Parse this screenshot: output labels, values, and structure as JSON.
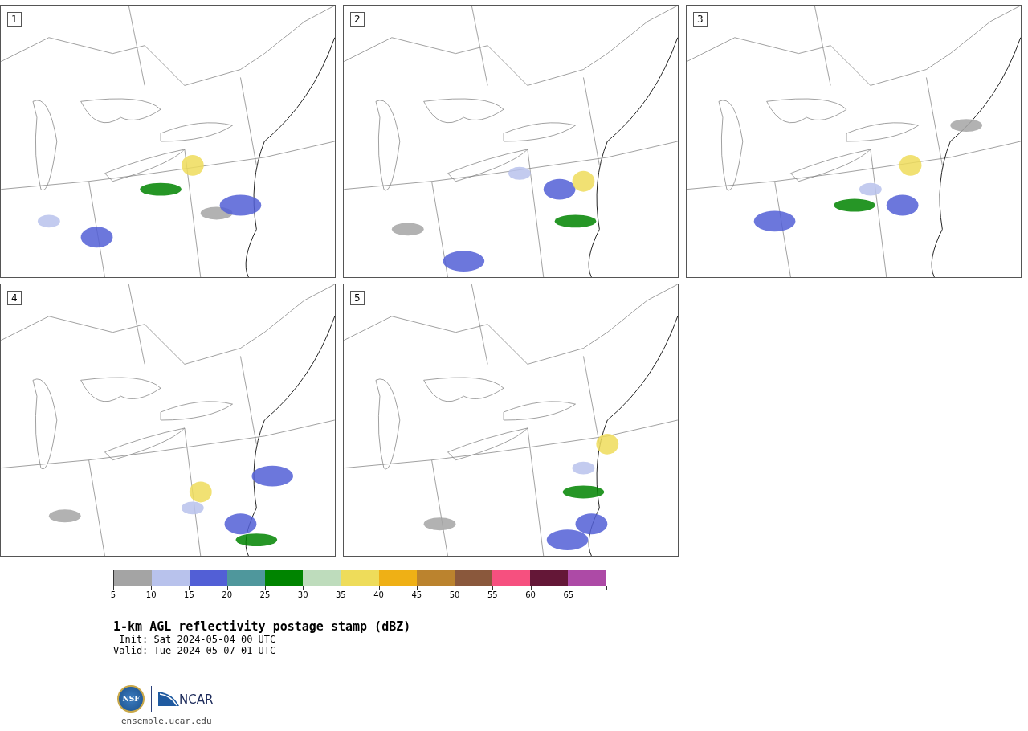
{
  "panels": [
    {
      "label": "1"
    },
    {
      "label": "2"
    },
    {
      "label": "3"
    },
    {
      "label": "4"
    },
    {
      "label": "5"
    }
  ],
  "colorbar": {
    "bins": [
      {
        "color": "#a4a4a4"
      },
      {
        "color": "#b8c2ec"
      },
      {
        "color": "#525fd6"
      },
      {
        "color": "#4f979c"
      },
      {
        "color": "#008400"
      },
      {
        "color": "#bedcbc"
      },
      {
        "color": "#eedc5a"
      },
      {
        "color": "#efb015"
      },
      {
        "color": "#bb832e"
      },
      {
        "color": "#8a583c"
      },
      {
        "color": "#f6507f"
      },
      {
        "color": "#641737"
      },
      {
        "color": "#ad4aa6"
      }
    ],
    "ticks": [
      "5",
      "10",
      "15",
      "20",
      "25",
      "30",
      "35",
      "40",
      "45",
      "50",
      "55",
      "60",
      "65"
    ]
  },
  "title": "1-km AGL reflectivity postage stamp (dBZ)",
  "init": " Init: Sat 2024-05-04 00 UTC",
  "valid": "Valid: Tue 2024-05-07 01 UTC",
  "logo": {
    "nsf": "NSF",
    "ncar": "NCAR"
  },
  "site": "ensemble.ucar.edu"
}
